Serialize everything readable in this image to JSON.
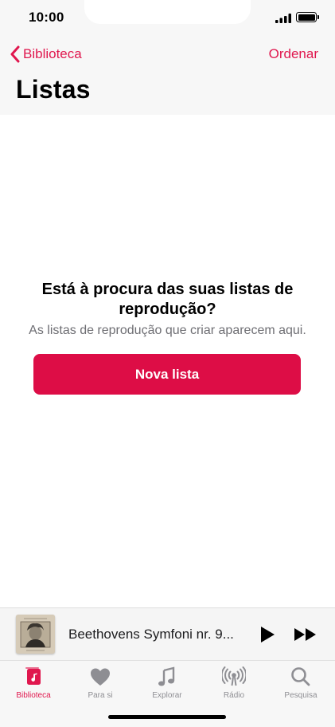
{
  "status_bar": {
    "time": "10:00"
  },
  "header": {
    "back_label": "Biblioteca",
    "order_label": "Ordenar",
    "title": "Listas"
  },
  "empty_state": {
    "title": "Está à procura das suas listas de reprodução?",
    "subtitle": "As listas de reprodução que criar aparecem aqui.",
    "button_label": "Nova lista"
  },
  "mini_player": {
    "track": "Beethovens Symfoni nr. 9..."
  },
  "tabs": [
    {
      "label": "Biblioteca",
      "icon": "library-icon",
      "active": true
    },
    {
      "label": "Para si",
      "icon": "heart-icon",
      "active": false
    },
    {
      "label": "Explorar",
      "icon": "music-note-icon",
      "active": false
    },
    {
      "label": "Rádio",
      "icon": "radio-icon",
      "active": false
    },
    {
      "label": "Pesquisa",
      "icon": "search-icon",
      "active": false
    }
  ],
  "colors": {
    "accent": "#e0174e",
    "button": "#dd0d46",
    "inactive": "#8e8e93"
  }
}
